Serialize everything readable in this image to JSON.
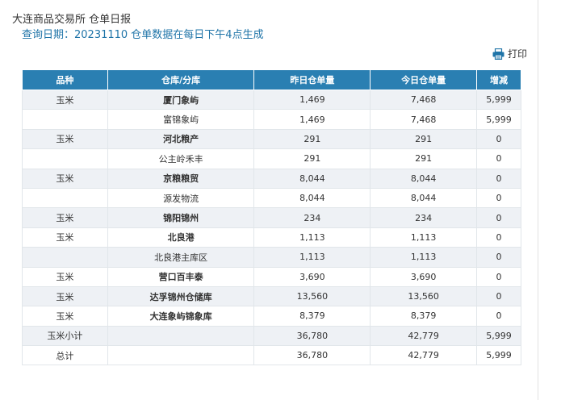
{
  "header": {
    "title": "大连商品交易所 仓单日报",
    "query_line": "查询日期：20231110 仓单数据在每日下午4点生成"
  },
  "toolbar": {
    "print_label": "打印",
    "print_icon": "printer-icon"
  },
  "table": {
    "columns": [
      "品种",
      "仓库/分库",
      "昨日仓单量",
      "今日仓单量",
      "增减"
    ],
    "rows": [
      {
        "variety": "玉米",
        "warehouse": "厦门象屿",
        "yesterday": "1,469",
        "today": "7,468",
        "change": "5,999",
        "main": true
      },
      {
        "variety": "",
        "warehouse": "富锦象屿",
        "yesterday": "1,469",
        "today": "7,468",
        "change": "5,999",
        "main": false
      },
      {
        "variety": "玉米",
        "warehouse": "河北粮产",
        "yesterday": "291",
        "today": "291",
        "change": "0",
        "main": true
      },
      {
        "variety": "",
        "warehouse": "公主岭禾丰",
        "yesterday": "291",
        "today": "291",
        "change": "0",
        "main": false
      },
      {
        "variety": "玉米",
        "warehouse": "京粮粮贸",
        "yesterday": "8,044",
        "today": "8,044",
        "change": "0",
        "main": true
      },
      {
        "variety": "",
        "warehouse": "源发物流",
        "yesterday": "8,044",
        "today": "8,044",
        "change": "0",
        "main": false
      },
      {
        "variety": "玉米",
        "warehouse": "锦阳锦州",
        "yesterday": "234",
        "today": "234",
        "change": "0",
        "main": true
      },
      {
        "variety": "玉米",
        "warehouse": "北良港",
        "yesterday": "1,113",
        "today": "1,113",
        "change": "0",
        "main": true
      },
      {
        "variety": "",
        "warehouse": "北良港主库区",
        "yesterday": "1,113",
        "today": "1,113",
        "change": "0",
        "main": false
      },
      {
        "variety": "玉米",
        "warehouse": "营口百丰泰",
        "yesterday": "3,690",
        "today": "3,690",
        "change": "0",
        "main": true
      },
      {
        "variety": "玉米",
        "warehouse": "达孚锦州仓储库",
        "yesterday": "13,560",
        "today": "13,560",
        "change": "0",
        "main": true
      },
      {
        "variety": "玉米",
        "warehouse": "大连象屿锦象库",
        "yesterday": "8,379",
        "today": "8,379",
        "change": "0",
        "main": true
      },
      {
        "variety": "玉米小计",
        "warehouse": "",
        "yesterday": "36,780",
        "today": "42,779",
        "change": "5,999",
        "main": false
      },
      {
        "variety": "总计",
        "warehouse": "",
        "yesterday": "36,780",
        "today": "42,779",
        "change": "5,999",
        "main": false
      }
    ]
  }
}
